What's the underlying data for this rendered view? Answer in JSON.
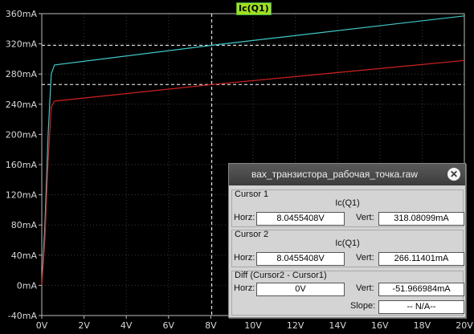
{
  "window": {
    "title": "вах_транзистора_рабочая_точка.raw",
    "close_glyph": "✕"
  },
  "trace_label": "Ic(Q1)",
  "chart_data": {
    "type": "line",
    "xlabel": "",
    "ylabel": "",
    "xlim": [
      0,
      20
    ],
    "ylim": [
      -40,
      360
    ],
    "x_unit": "V",
    "y_unit": "mA",
    "grid": true,
    "x_ticks": [
      "0V",
      "2V",
      "4V",
      "6V",
      "8V",
      "10V",
      "12V",
      "14V",
      "16V",
      "18V",
      "20V"
    ],
    "y_ticks": [
      "-40mA",
      "0mA",
      "40mA",
      "80mA",
      "120mA",
      "160mA",
      "200mA",
      "240mA",
      "280mA",
      "320mA",
      "360mA"
    ],
    "series": [
      {
        "name": "",
        "color": "#40c8c8",
        "x": [
          0,
          0.15,
          0.3,
          0.45,
          0.6,
          8.0455,
          20
        ],
        "y": [
          0,
          80,
          200,
          280,
          292,
          318.08,
          357
        ]
      },
      {
        "name": "",
        "color": "#d02020",
        "x": [
          0,
          0.15,
          0.3,
          0.45,
          0.6,
          8.0455,
          20
        ],
        "y": [
          0,
          60,
          165,
          236,
          244,
          266.11,
          298
        ]
      }
    ],
    "cursors": [
      {
        "x": 8.0455408,
        "y": 318.08099
      },
      {
        "x": 8.0455408,
        "y": 266.11401
      }
    ]
  },
  "panel": {
    "cursor1": {
      "title": "Cursor 1",
      "trace": "Ic(Q1)",
      "horz_label": "Horz:",
      "horz_value": "8.0455408V",
      "vert_label": "Vert:",
      "vert_value": "318.08099mA"
    },
    "cursor2": {
      "title": "Cursor 2",
      "trace": "Ic(Q1)",
      "horz_label": "Horz:",
      "horz_value": "8.0455408V",
      "vert_label": "Vert:",
      "vert_value": "266.11401mA"
    },
    "diff": {
      "title": "Diff (Cursor2 - Cursor1)",
      "horz_label": "Horz:",
      "horz_value": "0V",
      "vert_label": "Vert:",
      "vert_value": "-51.966984mA",
      "slope_label": "Slope:",
      "slope_value": "-- N/A--"
    }
  }
}
